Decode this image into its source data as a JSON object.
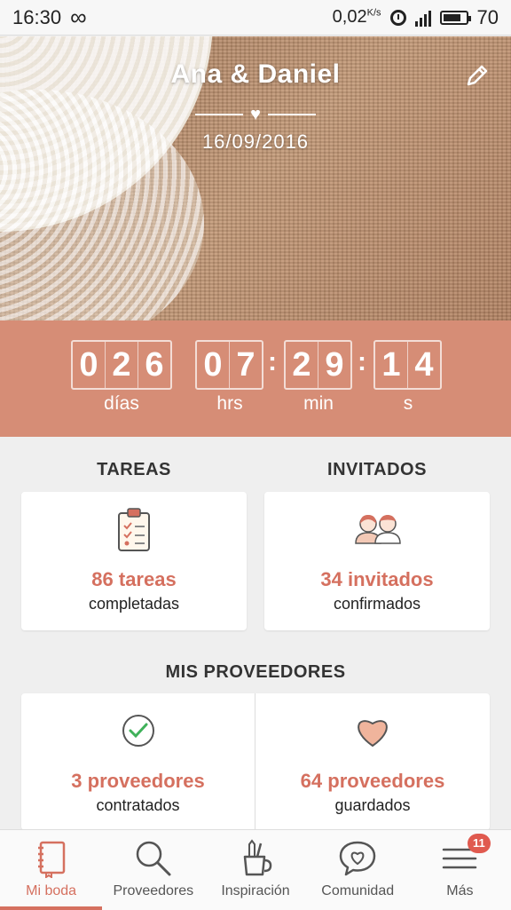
{
  "status_bar": {
    "time": "16:30",
    "infinity_symbol": "∞",
    "network_speed": "0,02",
    "network_unit": "K/s",
    "battery_level": "70"
  },
  "hero": {
    "couple_names": "Ana & Daniel",
    "wedding_date": "16/09/2016",
    "divider_heart": "♥"
  },
  "countdown": {
    "days_digits": [
      "0",
      "2",
      "6"
    ],
    "hours_digits": [
      "0",
      "7"
    ],
    "minutes_digits": [
      "2",
      "9"
    ],
    "seconds_digits": [
      "1",
      "4"
    ],
    "separator": ":",
    "labels": {
      "days": "días",
      "hours": "hrs",
      "minutes": "min",
      "seconds": "s"
    }
  },
  "sections": {
    "tasks": {
      "title": "TAREAS",
      "value": "86 tareas",
      "subtitle": "completadas"
    },
    "guests": {
      "title": "INVITADOS",
      "value": "34 invitados",
      "subtitle": "confirmados"
    },
    "vendors": {
      "title": "MIS PROVEEDORES",
      "hired": {
        "value": "3 proveedores",
        "subtitle": "contratados"
      },
      "saved": {
        "value": "64 proveedores",
        "subtitle": "guardados"
      }
    }
  },
  "bottom_nav": {
    "items": [
      {
        "label": "Mi boda",
        "icon": "notebook-icon",
        "active": true
      },
      {
        "label": "Proveedores",
        "icon": "search-icon"
      },
      {
        "label": "Inspiración",
        "icon": "pencil-cup-icon"
      },
      {
        "label": "Comunidad",
        "icon": "chat-heart-icon"
      },
      {
        "label": "Más",
        "icon": "menu-icon"
      }
    ],
    "more_badge": "11"
  },
  "colors": {
    "accent": "#d5705f",
    "countdown_bg": "#d68d76",
    "background": "#efefef"
  }
}
